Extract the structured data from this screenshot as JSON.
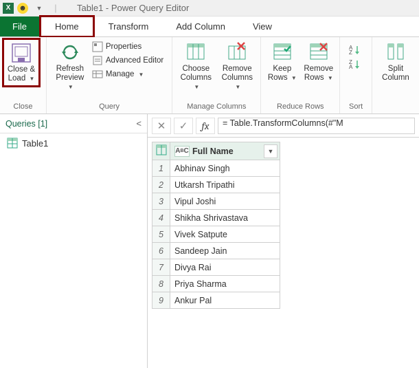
{
  "title": "Table1 - Power Query Editor",
  "tabs": {
    "file": "File",
    "home": "Home",
    "transform": "Transform",
    "add_column": "Add Column",
    "view": "View"
  },
  "ribbon": {
    "close": {
      "close_load": "Close &\nLoad",
      "group": "Close"
    },
    "query": {
      "refresh": "Refresh\nPreview",
      "properties": "Properties",
      "advanced": "Advanced Editor",
      "manage": "Manage",
      "group": "Query"
    },
    "manage_cols": {
      "choose": "Choose\nColumns",
      "remove": "Remove\nColumns",
      "group": "Manage Columns"
    },
    "reduce_rows": {
      "keep": "Keep\nRows",
      "remove": "Remove\nRows",
      "group": "Reduce Rows"
    },
    "sort": {
      "split": "Split\nColumn",
      "group": "Sort"
    }
  },
  "queries": {
    "header": "Queries [1]",
    "items": [
      {
        "name": "Table1"
      }
    ]
  },
  "formula": {
    "fx": "fx",
    "value": "= Table.TransformColumns(#\"M"
  },
  "grid": {
    "column": "Full Name",
    "type_prefix": "A",
    "type_suffix": "C",
    "rows": [
      "Abhinav Singh",
      "Utkarsh Tripathi",
      "Vipul Joshi",
      "Shikha Shrivastava",
      "Vivek Satpute",
      "Sandeep Jain",
      "Divya Rai",
      "Priya Sharma",
      "Ankur Pal"
    ]
  }
}
